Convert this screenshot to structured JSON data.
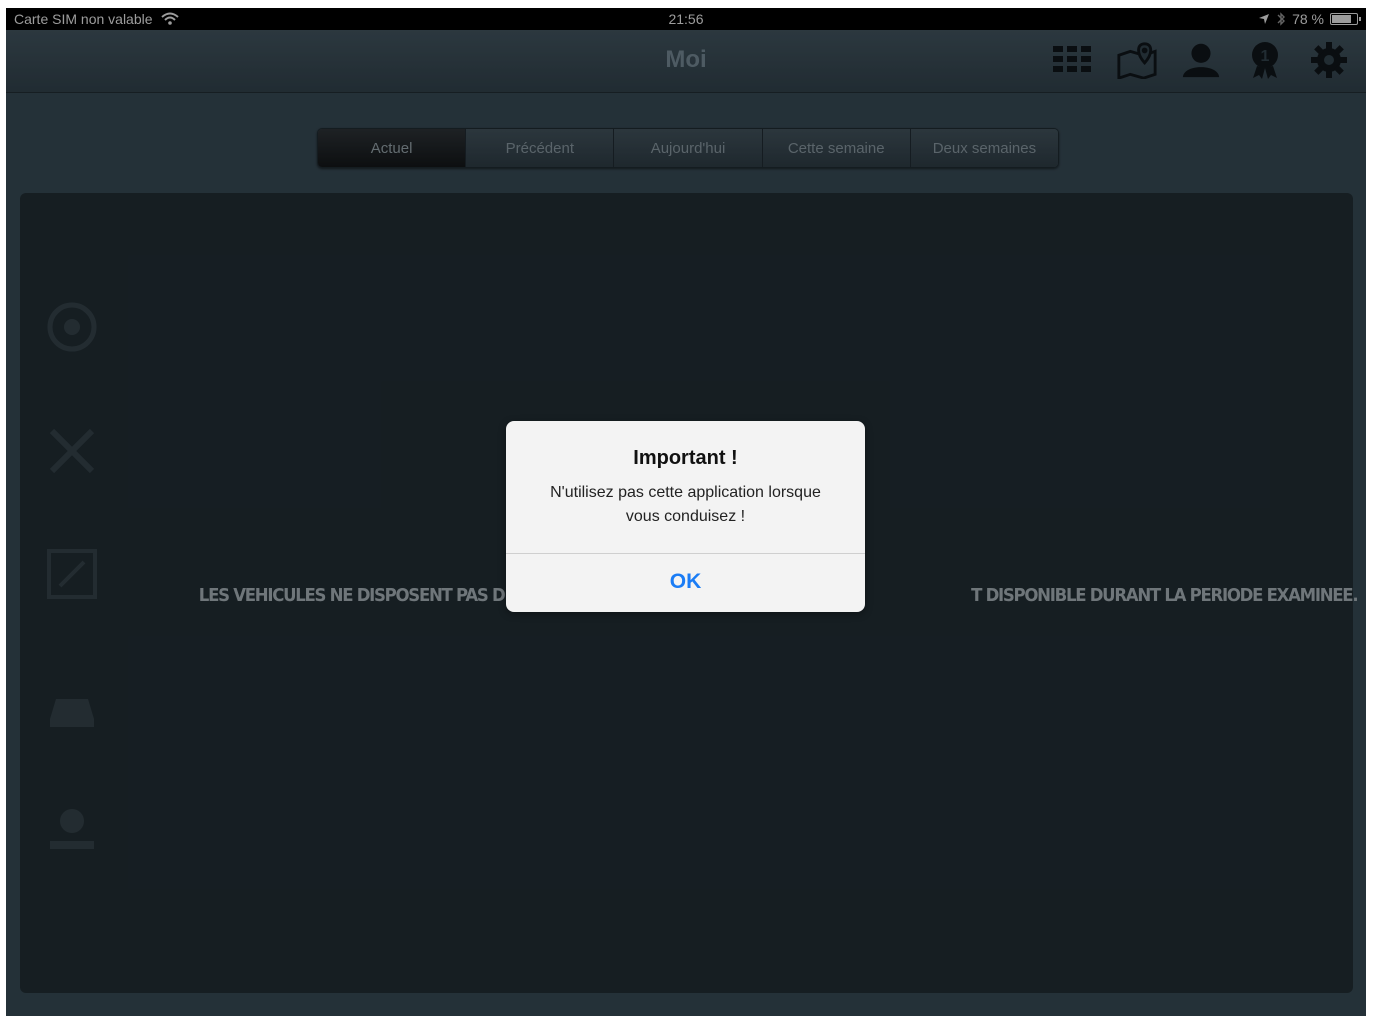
{
  "status_bar": {
    "carrier": "Carte SIM non valable",
    "time": "21:56",
    "battery_text": "78 %",
    "battery_level": 0.78
  },
  "nav": {
    "title": "Moi",
    "icons": [
      "grid-icon",
      "map-pin-icon",
      "user-icon",
      "badge-icon",
      "gear-icon"
    ]
  },
  "tabs": [
    {
      "label": "Actuel",
      "active": true
    },
    {
      "label": "Précédent",
      "active": false
    },
    {
      "label": "Aujourd'hui",
      "active": false
    },
    {
      "label": "Cette semaine",
      "active": false
    },
    {
      "label": "Deux semaines",
      "active": false
    }
  ],
  "main": {
    "message": "LES VEHICULES NE DISPOSENT PAS DU SERVICE                                                                                     T DISPONIBLE DURANT LA PERIODE EXAMINEE."
  },
  "alert": {
    "title": "Important !",
    "message": "N'utilisez pas cette application lorsque vous conduisez !",
    "ok_label": "OK"
  },
  "colors": {
    "background": "#33444e",
    "panel": "#1f2a30",
    "alert_button": "#1a7cf5"
  }
}
